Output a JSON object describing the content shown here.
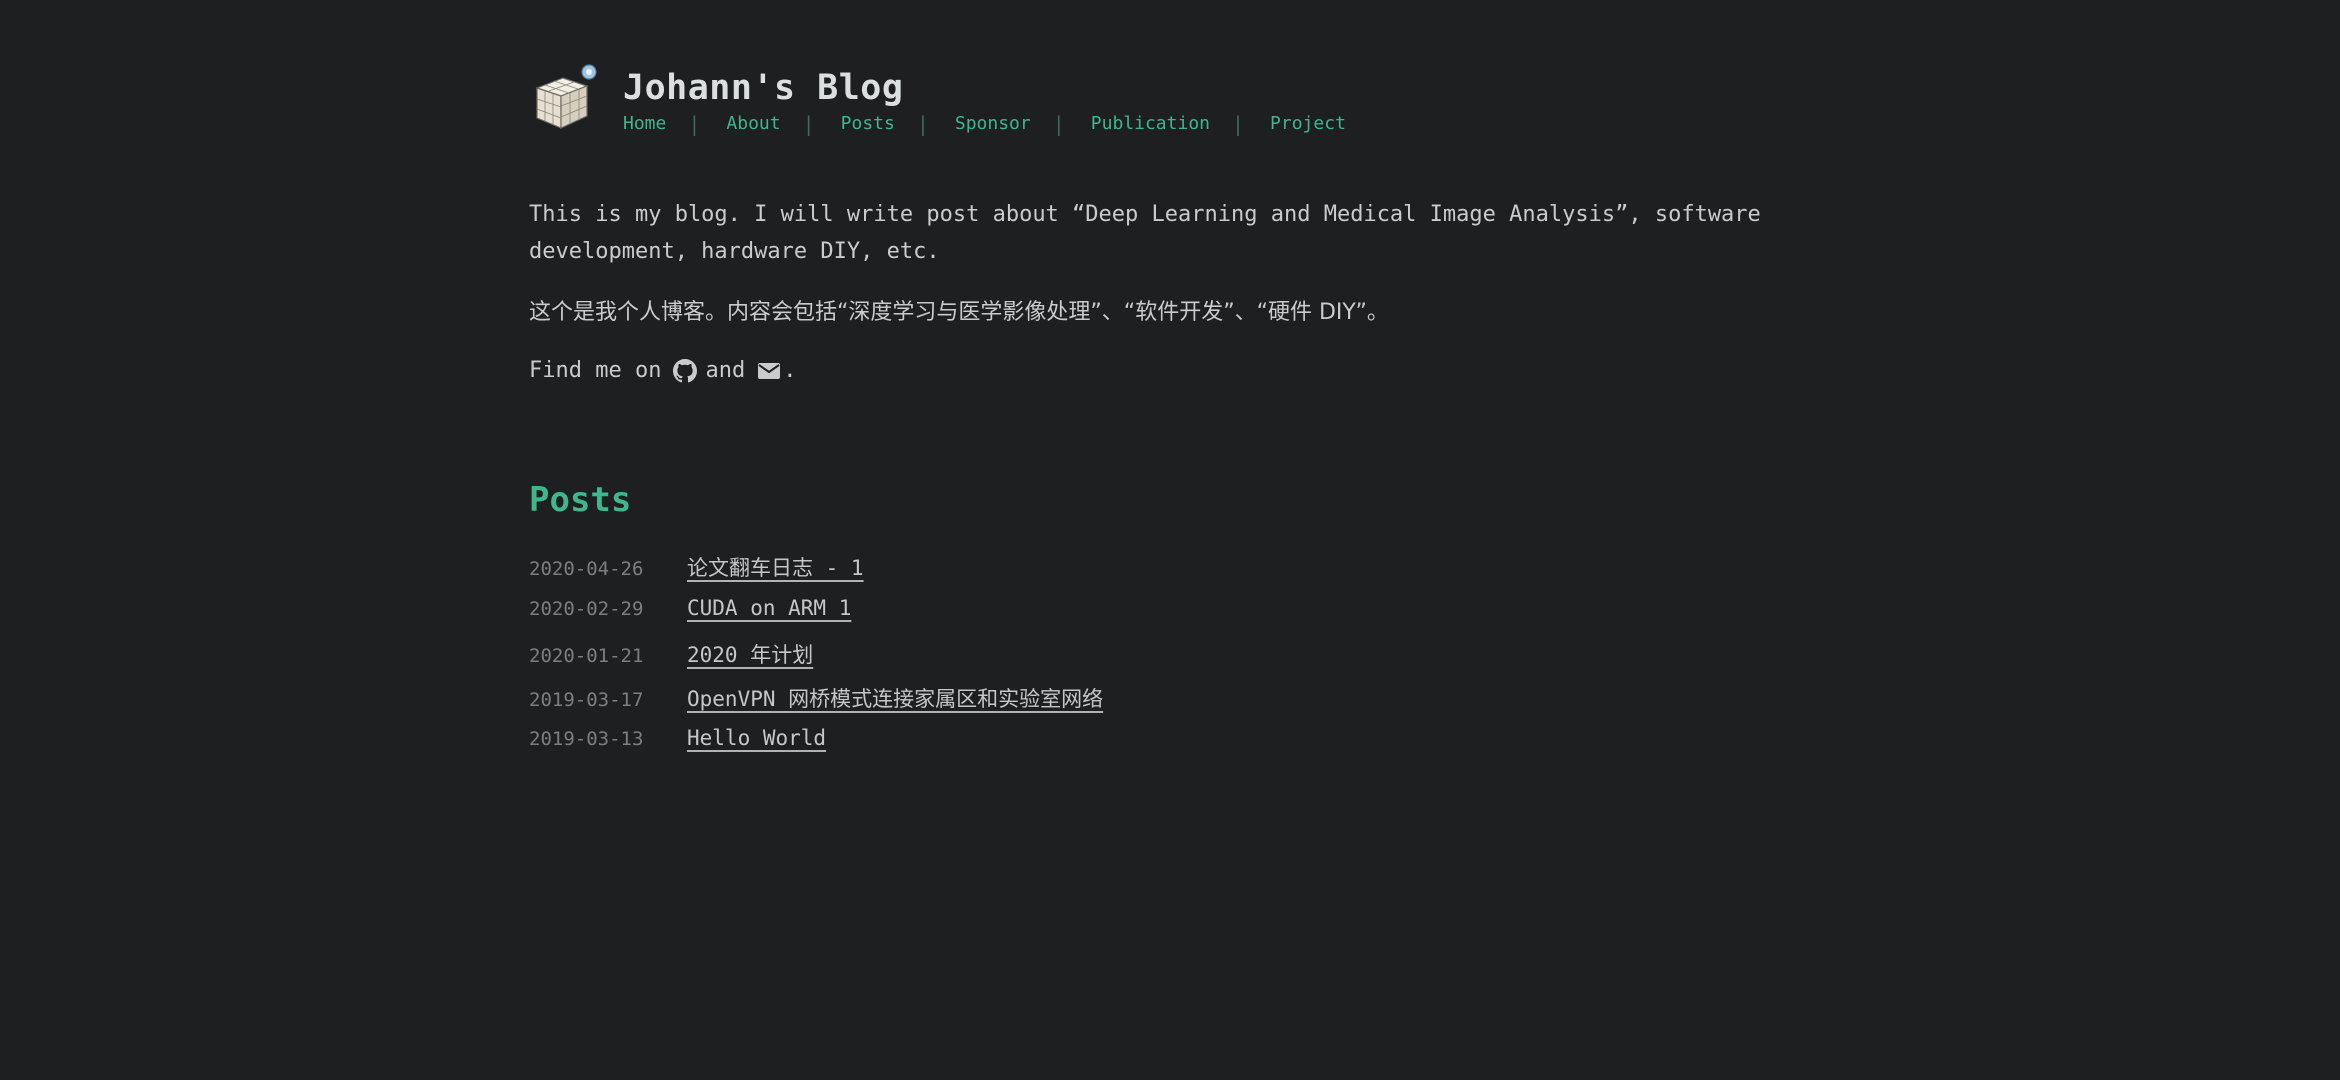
{
  "site": {
    "title": "Johann's Blog"
  },
  "nav": {
    "items": [
      {
        "label": "Home"
      },
      {
        "label": "About"
      },
      {
        "label": "Posts"
      },
      {
        "label": "Sponsor"
      },
      {
        "label": "Publication"
      },
      {
        "label": "Project"
      }
    ]
  },
  "intro": {
    "paragraph_en": "This is my blog. I will write post about “Deep Learning and Medical Image Analysis”, software development, hardware DIY, etc.",
    "paragraph_zh": "这个是我个人博客。内容会包括“深度学习与医学影像处理”、“软件开发”、“硬件 DIY”。",
    "find_me_prefix": "Find me on",
    "find_me_and": "and",
    "find_me_suffix": ".",
    "icons": [
      "github-icon",
      "envelope-icon"
    ]
  },
  "posts": {
    "heading": "Posts",
    "items": [
      {
        "date": "2020-04-26",
        "title": "论文翻车日志 - 1"
      },
      {
        "date": "2020-02-29",
        "title": "CUDA on ARM 1"
      },
      {
        "date": "2020-01-21",
        "title": "2020 年计划"
      },
      {
        "date": "2019-03-17",
        "title": "OpenVPN 网桥模式连接家属区和实验室网络"
      },
      {
        "date": "2019-03-13",
        "title": "Hello World"
      }
    ]
  },
  "colors": {
    "background": "#1d1f21",
    "accent": "#3fb68b",
    "text": "#c5c8c6",
    "muted": "#7c7f81"
  }
}
